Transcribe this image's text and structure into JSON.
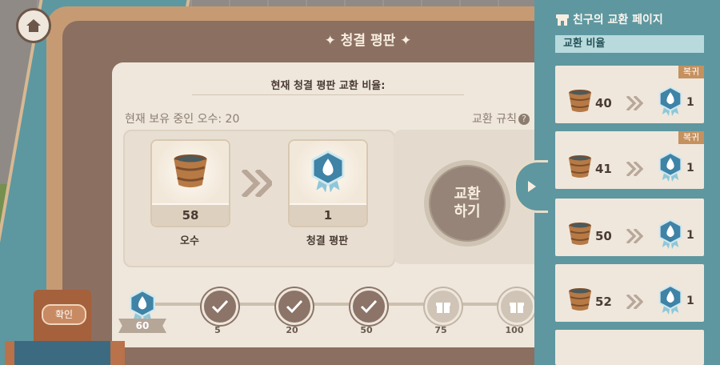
{
  "header": {
    "title": "✦ 청결 평판 ✦"
  },
  "exchange": {
    "subtitle": "현재 청결 평판 교환 비율:",
    "owned_label": "현재 보유 중인 오수: 20",
    "rules_label": "교환 규칙",
    "rules_icon": "?",
    "from": {
      "value": "58",
      "label": "오수",
      "icon": "bucket-icon"
    },
    "to": {
      "value": "1",
      "label": "청결 평판",
      "icon": "water-medal-icon"
    },
    "button_line1": "교환",
    "button_line2": "하기"
  },
  "progress": {
    "current": "60",
    "milestones": [
      {
        "label": "5",
        "state": "done"
      },
      {
        "label": "20",
        "state": "done"
      },
      {
        "label": "50",
        "state": "done"
      },
      {
        "label": "75",
        "state": "gift"
      },
      {
        "label": "100",
        "state": "gift"
      }
    ]
  },
  "confirm_label": "확인",
  "side_panel": {
    "title": "친구의 교환 페이지",
    "rate_header": "교환 비율",
    "rows": [
      {
        "water": "40",
        "rep": "1",
        "tag": "복귀"
      },
      {
        "water": "41",
        "rep": "1",
        "tag": "복귀"
      },
      {
        "water": "50",
        "rep": "1",
        "tag": ""
      },
      {
        "water": "52",
        "rep": "1",
        "tag": ""
      }
    ]
  },
  "colors": {
    "accent": "#5e97a0",
    "panel": "#efe7dc",
    "brown": "#8b6f61"
  }
}
